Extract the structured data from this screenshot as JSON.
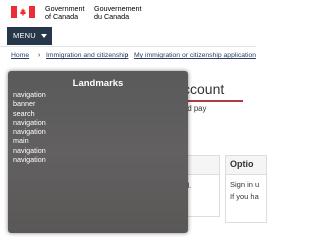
{
  "header": {
    "flag_icon": "canada-flag-icon",
    "gov_en_line1": "Government",
    "gov_en_line2": "of Canada",
    "gov_fr_line1": "Gouvernement",
    "gov_fr_line2": "du Canada"
  },
  "menu": {
    "label": "MENU"
  },
  "breadcrumb": {
    "items": [
      {
        "label": "Home"
      },
      {
        "label": "Immigration and citizenship"
      },
      {
        "label": "My immigration or citizenship application"
      }
    ],
    "separator": "›"
  },
  "main": {
    "title_partial": "ccount",
    "lead_partial": "nd pay",
    "box_left_text": "d.",
    "box_right_title": "Optio",
    "box_right_line1": "Sign in u",
    "box_right_line2": "If you ha"
  },
  "landmarks_dialog": {
    "title": "Landmarks",
    "items": [
      "navigation",
      "banner",
      "search",
      "navigation",
      "navigation",
      "main",
      "navigation",
      "navigation"
    ]
  },
  "colors": {
    "menu_bg": "#26374a",
    "flag_red": "#eb2d37",
    "link": "#284162",
    "title_accent": "#af3c43",
    "overlay_bg": "#5f5e5d"
  }
}
